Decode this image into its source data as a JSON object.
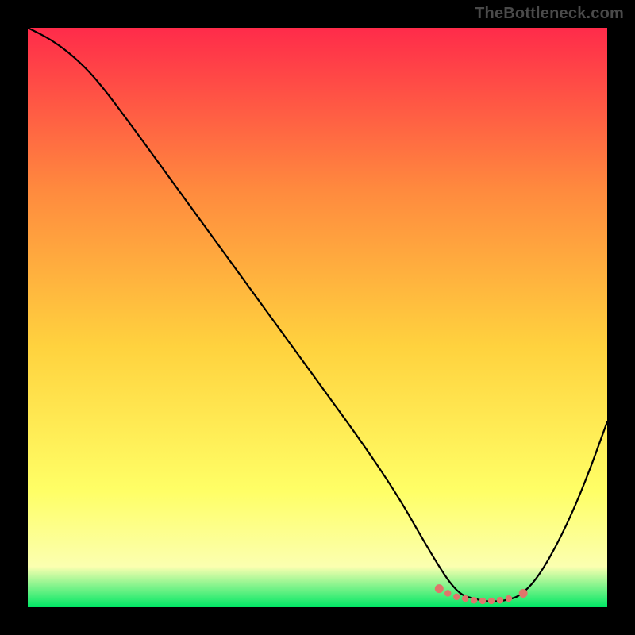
{
  "watermark": "TheBottleneck.com",
  "colors": {
    "gradient_top": "#ff2b4a",
    "gradient_mid_upper": "#ff8a3e",
    "gradient_mid": "#ffd23e",
    "gradient_mid_lower": "#ffff66",
    "gradient_lower": "#fbffb0",
    "gradient_bottom": "#00e765",
    "curve": "#000000",
    "dots": "#e0756b",
    "frame": "#000000"
  },
  "chart_data": {
    "type": "line",
    "title": "",
    "xlabel": "",
    "ylabel": "",
    "xlim": [
      0,
      100
    ],
    "ylim": [
      0,
      100
    ],
    "series": [
      {
        "name": "bottleneck-curve",
        "x": [
          0,
          4,
          8,
          12,
          18,
          26,
          34,
          42,
          50,
          58,
          64,
          68,
          71,
          73,
          75,
          77,
          79,
          81,
          83,
          85,
          88,
          92,
          96,
          100
        ],
        "y": [
          100,
          98,
          95,
          91,
          83,
          72,
          61,
          50,
          39,
          28,
          19,
          12,
          7,
          4,
          2,
          1.5,
          1,
          1,
          1.3,
          2,
          5,
          12,
          21,
          32
        ]
      }
    ],
    "flat_region_markers": {
      "name": "optimal-range-dots",
      "x": [
        71,
        72.5,
        74,
        75.5,
        77,
        78.5,
        80,
        81.5,
        83,
        85.5
      ],
      "y": [
        3.2,
        2.4,
        1.8,
        1.5,
        1.2,
        1.1,
        1.1,
        1.2,
        1.5,
        2.4
      ]
    }
  }
}
